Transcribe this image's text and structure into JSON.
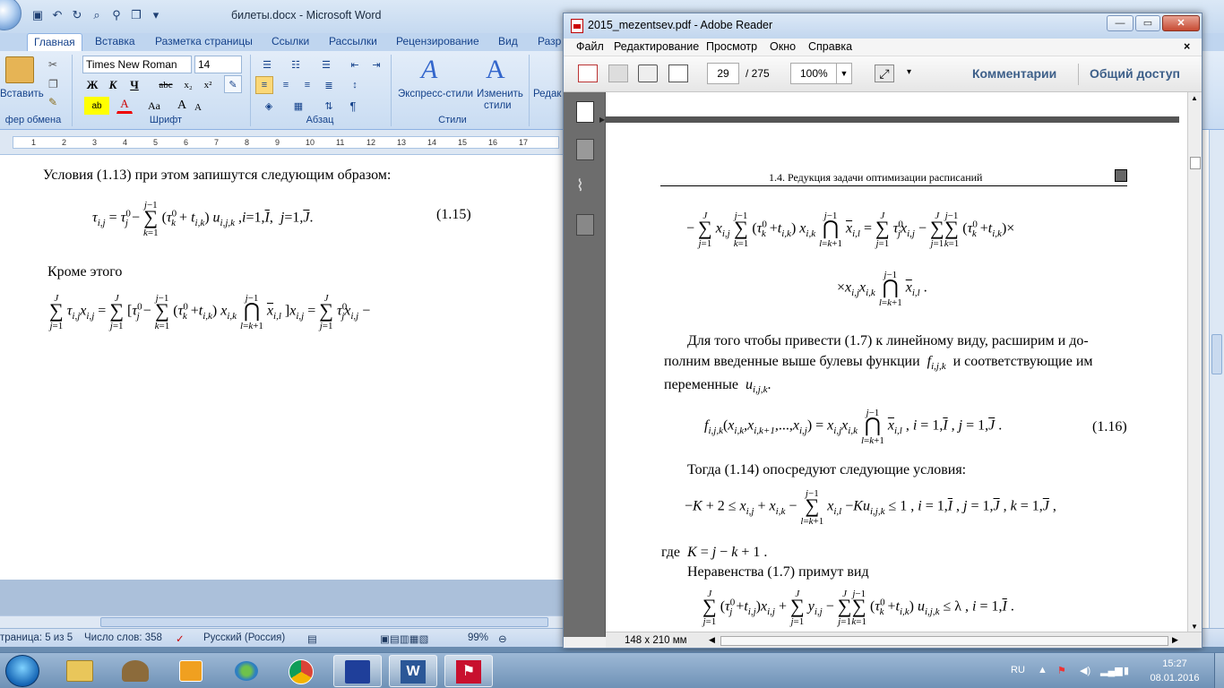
{
  "word": {
    "window_title": "билеты.docx - Microsoft Word",
    "tabs": [
      "Главная",
      "Вставка",
      "Разметка страницы",
      "Ссылки",
      "Рассылки",
      "Рецензирование",
      "Вид",
      "Разр"
    ],
    "clipboard": {
      "paste_label": "Вставить",
      "group_label": "фер обмена"
    },
    "font": {
      "name": "Times New Roman",
      "size": "14",
      "group_label": "Шрифт",
      "bold": "Ж",
      "italic": "К",
      "underline": "Ч",
      "strike": "abc",
      "subscript": "x₂",
      "superscript": "x²",
      "case": "Aa",
      "grow": "A",
      "shrink": "A"
    },
    "paragraph": {
      "group_label": "Абзац",
      "pilcrow": "¶"
    },
    "styles": {
      "group_label": "Стили",
      "express_label": "Экспресс-стили",
      "change_label_1": "Изменить",
      "change_label_2": "стили",
      "editing_label": "Редак"
    },
    "ruler_ticks": [
      "1",
      "2",
      "3",
      "4",
      "5",
      "6",
      "7",
      "8",
      "9",
      "10",
      "11",
      "12",
      "13",
      "14",
      "15",
      "16",
      "17"
    ],
    "doc": {
      "line1": "Условия (1.13) при этом запишутся следующим образом:",
      "eq_number": "(1.15)",
      "line2": "Кроме этого"
    },
    "status": {
      "page": "траница: 5 из 5",
      "words": "Число слов: 358",
      "lang": "Русский (Россия)",
      "zoom": "99%"
    }
  },
  "reader": {
    "window_title": "2015_mezentsev.pdf - Adobe Reader",
    "menu": [
      "Файл",
      "Редактирование",
      "Просмотр",
      "Окно",
      "Справка"
    ],
    "page_current": "29",
    "page_total": "/ 275",
    "zoom": "100%",
    "comments_label": "Комментарии",
    "share_label": "Общий доступ",
    "running_head": "1.4. Редукция задачи оптимизации расписаний",
    "para1_line1": "Для того чтобы привести (1.7) к линейному виду, расширим и до-",
    "para1_line2": "полним введенные выше булевы функции",
    "para1_line2b": "и соответствующие им",
    "para1_line3": "переменные",
    "eq116_number": "(1.16)",
    "para2": "Тогда (1.14) опосредуют следующие условия:",
    "where": "где",
    "para3": "Неравенства (1.7) примут вид",
    "page_size": "148 x 210 мм"
  },
  "taskbar": {
    "lang": "RU",
    "time": "15:27",
    "date": "08.01.2016"
  },
  "colors": {
    "word_ribbon": "#c9dcf2",
    "word_tab_text": "#15428b",
    "reader_accent": "#3d5f89",
    "taskbar": "#6f92b6"
  }
}
